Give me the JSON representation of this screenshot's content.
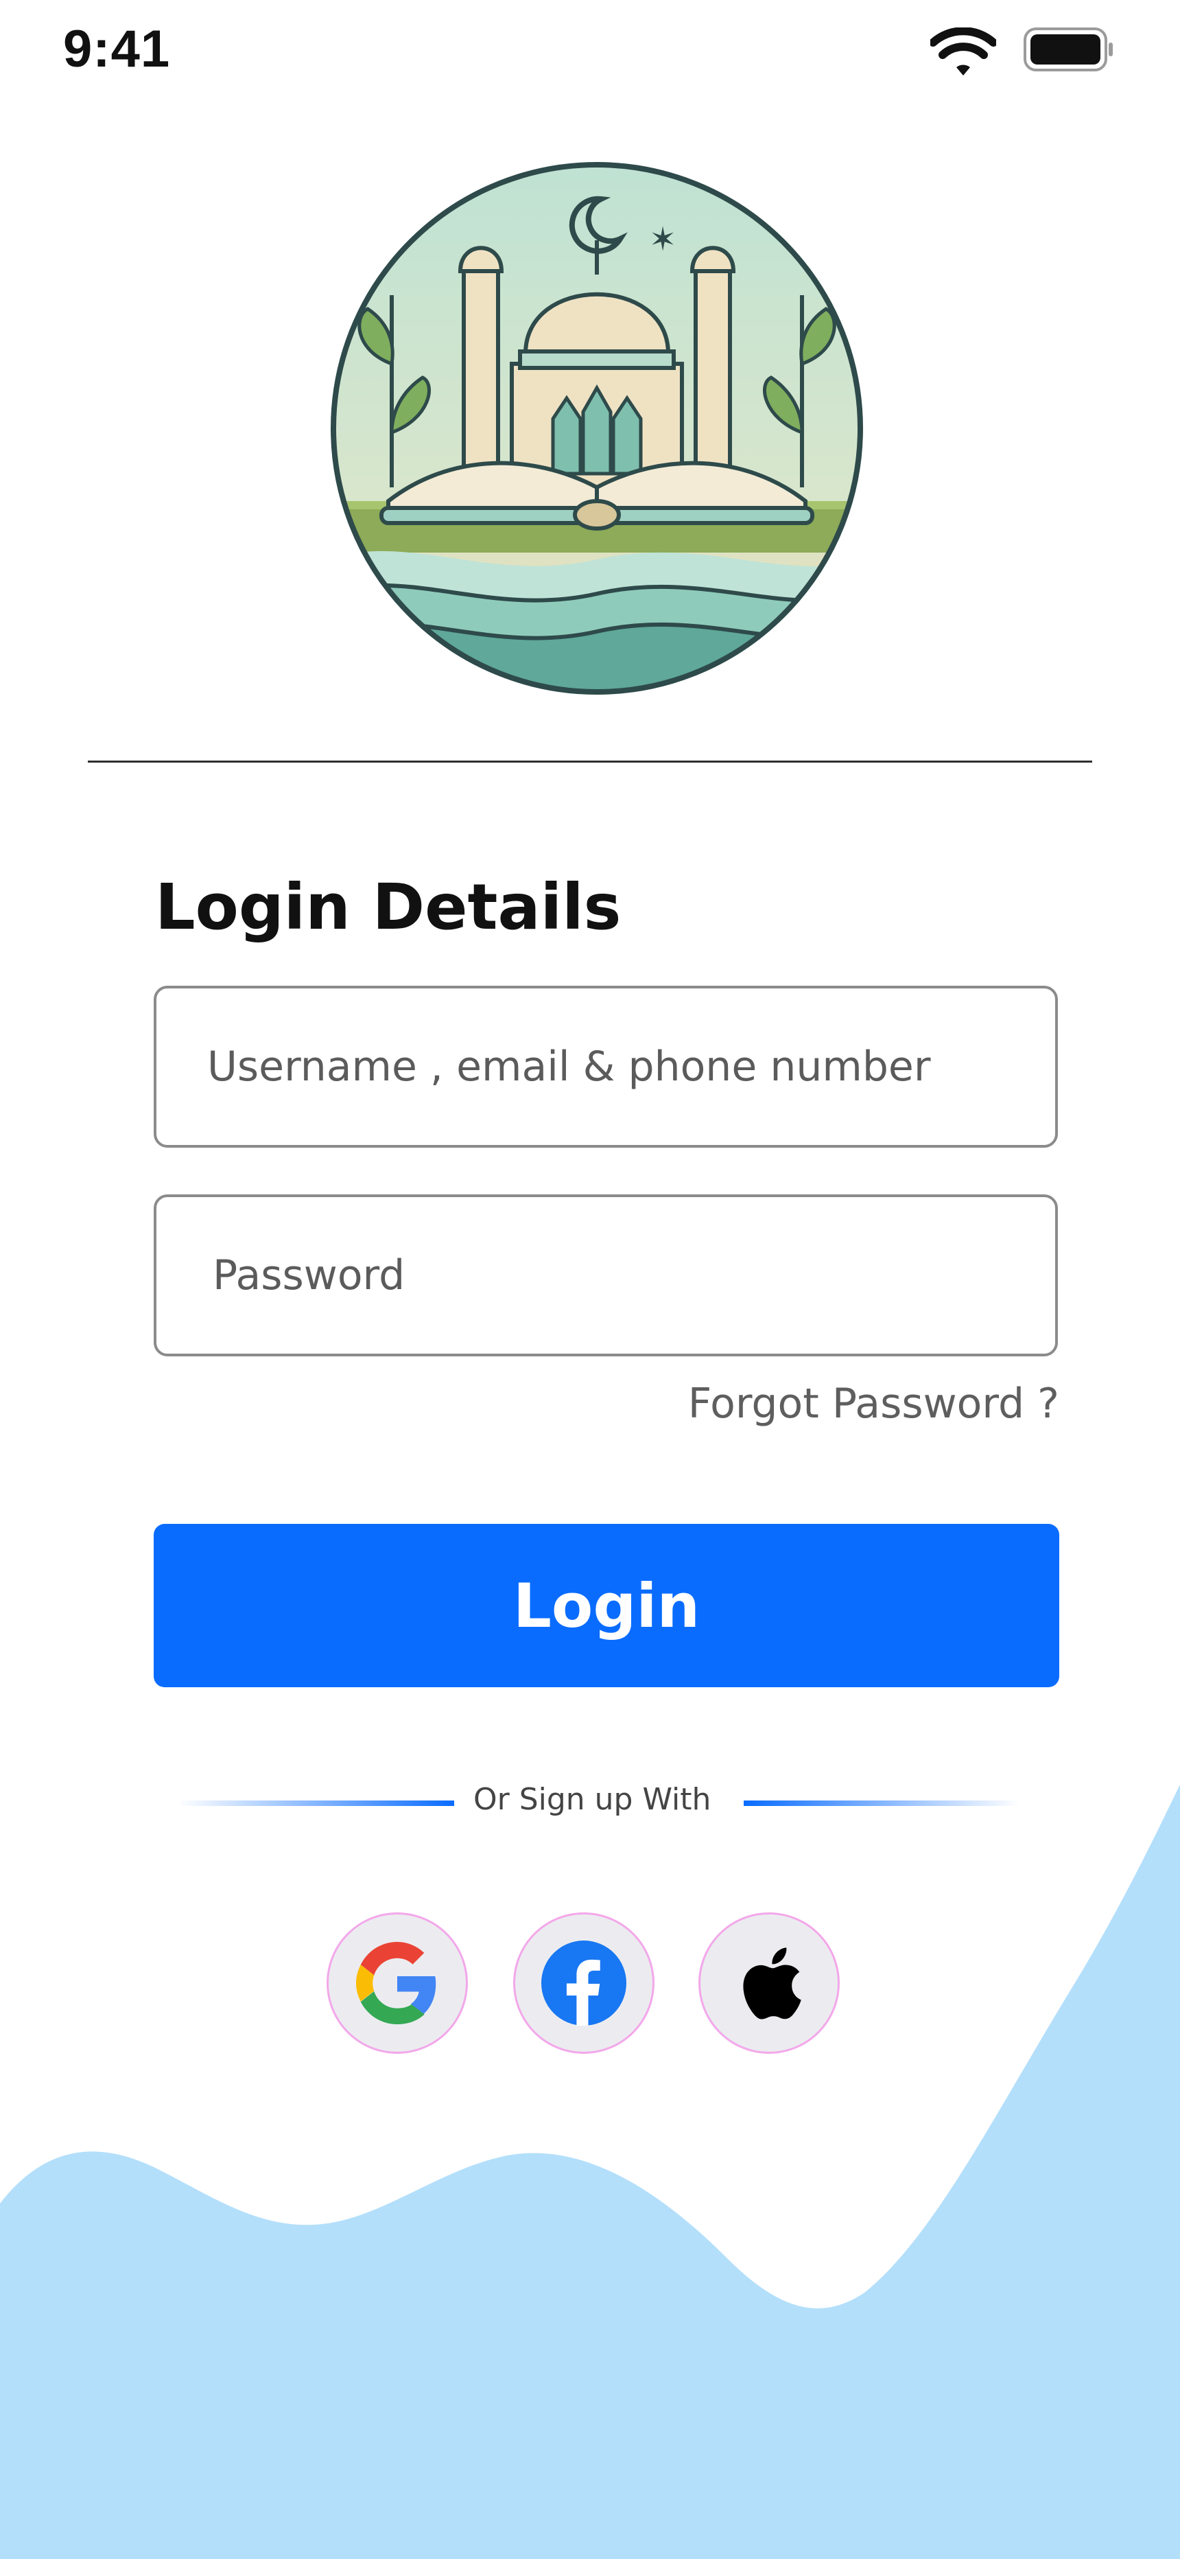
{
  "status_bar": {
    "time": "9:41",
    "icons": [
      "wifi-icon",
      "battery-icon"
    ]
  },
  "logo": {
    "icon": "mosque-book-logo"
  },
  "login": {
    "title": "Login Details",
    "username_placeholder": "Username , email & phone number",
    "password_placeholder": "Password",
    "forgot_label": "Forgot Password ?",
    "login_button": "Login",
    "or_text": "Or Sign up With"
  },
  "social": [
    {
      "name": "Google",
      "icon": "google-icon"
    },
    {
      "name": "Facebook",
      "icon": "facebook-icon"
    },
    {
      "name": "Apple",
      "icon": "apple-icon"
    }
  ],
  "colors": {
    "accent": "#0a6cff",
    "wave": "#b3dffb",
    "border": "#8b8b8b",
    "social_border": "#f3a8ea"
  }
}
